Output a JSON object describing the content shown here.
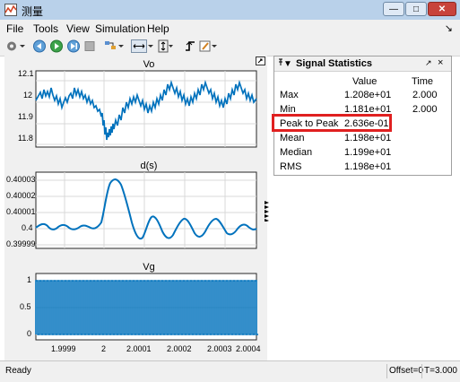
{
  "window": {
    "title": "测量",
    "min": "—",
    "max": "□",
    "close": "✕"
  },
  "menu": {
    "items": [
      "File",
      "Tools",
      "View",
      "Simulation",
      "Help"
    ],
    "overflow": "↘"
  },
  "plots": {
    "vo": {
      "title": "Vo",
      "yticks": [
        "12.1",
        "12",
        "11.9",
        "11.8"
      ]
    },
    "ds": {
      "title": "d(s)",
      "yticks": [
        "0.40003",
        "0.40002",
        "0.40001",
        "0.4",
        "0.39999"
      ]
    },
    "vg": {
      "title": "Vg",
      "yticks": [
        "1",
        "0.5",
        "0"
      ]
    },
    "xticks": [
      "1.9999",
      "2",
      "2.0001",
      "2.0002",
      "2.0003",
      "2.0004"
    ]
  },
  "stats": {
    "title": "Signal Statistics",
    "menu_glyph": "▼",
    "col_value": "Value",
    "col_time": "Time",
    "rows": [
      {
        "label": "Max",
        "value": "1.208e+01",
        "time": "2.000"
      },
      {
        "label": "Min",
        "value": "1.181e+01",
        "time": "2.000"
      },
      {
        "label": "Peak to Peak",
        "value": "2.636e-01",
        "time": ""
      },
      {
        "label": "Mean",
        "value": "1.198e+01",
        "time": ""
      },
      {
        "label": "Median",
        "value": "1.199e+01",
        "time": ""
      },
      {
        "label": "RMS",
        "value": "1.198e+01",
        "time": ""
      }
    ]
  },
  "status": {
    "left": "Ready",
    "offset": "Offset=0",
    "time": "T=3.000"
  },
  "colors": {
    "trace": "#0072bd",
    "highlight": "#e02020"
  }
}
